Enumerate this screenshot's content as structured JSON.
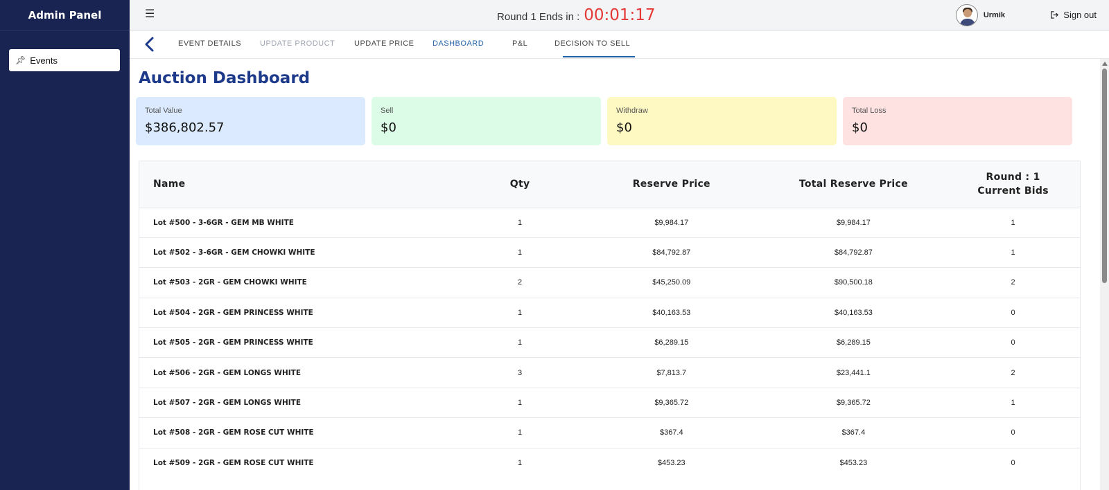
{
  "sidebar": {
    "brand": "Admin Panel",
    "items": [
      {
        "label": "Events",
        "icon": "pin-icon"
      }
    ]
  },
  "topbar": {
    "round_label": "Round 1 Ends in :",
    "round_time": "00:01:17",
    "user_name": "Urmik",
    "signout_label": "Sign out"
  },
  "tabs": [
    {
      "label": "EVENT DETAILS",
      "state": "normal"
    },
    {
      "label": "UPDATE PRODUCT",
      "state": "disabled"
    },
    {
      "label": "UPDATE PRICE",
      "state": "normal"
    },
    {
      "label": "DASHBOARD",
      "state": "active"
    },
    {
      "label": "P&L",
      "state": "normal"
    },
    {
      "label": "DECISION TO SELL",
      "state": "normal"
    }
  ],
  "page_title": "Auction Dashboard",
  "cards": [
    {
      "label": "Total Value",
      "value": "$386,802.57",
      "color": "#dbeafe"
    },
    {
      "label": "Sell",
      "value": "$0",
      "color": "#dcfce7"
    },
    {
      "label": "Withdraw",
      "value": "$0",
      "color": "#fef9c3"
    },
    {
      "label": "Total Loss",
      "value": "$0",
      "color": "#fee2e2"
    }
  ],
  "table": {
    "headers": {
      "name": "Name",
      "qty": "Qty",
      "reserve_price": "Reserve Price",
      "total_reserve_price": "Total Reserve Price",
      "round_line1": "Round : 1",
      "round_line2": "Current Bids"
    },
    "rows": [
      {
        "name": "Lot #500 - 3-6GR - GEM MB WHITE",
        "qty": "1",
        "reserve": "$9,984.17",
        "total": "$9,984.17",
        "bids": "1"
      },
      {
        "name": "Lot #502 - 3-6GR - GEM CHOWKI WHITE",
        "qty": "1",
        "reserve": "$84,792.87",
        "total": "$84,792.87",
        "bids": "1"
      },
      {
        "name": "Lot #503 - 2GR - GEM CHOWKI WHITE",
        "qty": "2",
        "reserve": "$45,250.09",
        "total": "$90,500.18",
        "bids": "2"
      },
      {
        "name": "Lot #504 - 2GR - GEM PRINCESS WHITE",
        "qty": "1",
        "reserve": "$40,163.53",
        "total": "$40,163.53",
        "bids": "0"
      },
      {
        "name": "Lot #505 - 2GR - GEM PRINCESS WHITE",
        "qty": "1",
        "reserve": "$6,289.15",
        "total": "$6,289.15",
        "bids": "0"
      },
      {
        "name": "Lot #506 - 2GR - GEM LONGS WHITE",
        "qty": "3",
        "reserve": "$7,813.7",
        "total": "$23,441.1",
        "bids": "2"
      },
      {
        "name": "Lot #507 - 2GR - GEM LONGS WHITE",
        "qty": "1",
        "reserve": "$9,365.72",
        "total": "$9,365.72",
        "bids": "1"
      },
      {
        "name": "Lot #508 - 2GR - GEM ROSE CUT WHITE",
        "qty": "1",
        "reserve": "$367.4",
        "total": "$367.4",
        "bids": "0"
      },
      {
        "name": "Lot #509 - 2GR - GEM ROSE CUT WHITE",
        "qty": "1",
        "reserve": "$453.23",
        "total": "$453.23",
        "bids": "0"
      }
    ]
  }
}
